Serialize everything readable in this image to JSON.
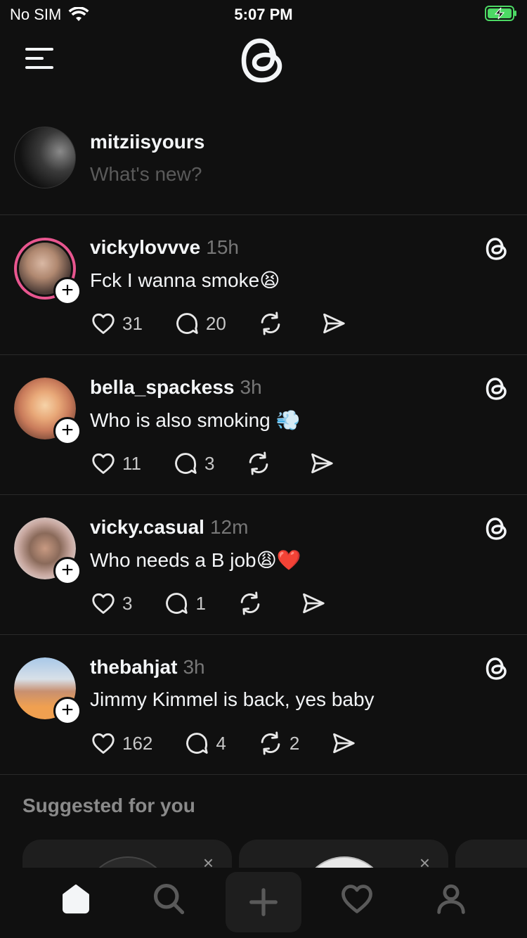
{
  "status_bar": {
    "carrier": "No SIM",
    "time": "5:07 PM"
  },
  "composer": {
    "username": "mitziisyours",
    "placeholder": "What's new?"
  },
  "posts": [
    {
      "username": "vickylovvve",
      "time": "15h",
      "text": "Fck I wanna smoke😫",
      "likes": "31",
      "replies": "20",
      "reposts": "",
      "story_ring": true
    },
    {
      "username": "bella_spackess",
      "time": "3h",
      "text": "Who is also smoking 💨",
      "likes": "11",
      "replies": "3",
      "reposts": "",
      "story_ring": false
    },
    {
      "username": "vicky.casual",
      "time": "12m",
      "text": "Who needs a B job😩❤️",
      "likes": "3",
      "replies": "1",
      "reposts": "",
      "story_ring": false
    },
    {
      "username": "thebahjat",
      "time": "3h",
      "text": "Jimmy Kimmel is back, yes baby",
      "likes": "162",
      "replies": "4",
      "reposts": "2",
      "story_ring": false
    }
  ],
  "suggested": {
    "title": "Suggested for you",
    "dismiss": "×"
  },
  "colors": {
    "background": "#101010",
    "story_ring": "#e8568f",
    "battery": "#4cd964"
  }
}
